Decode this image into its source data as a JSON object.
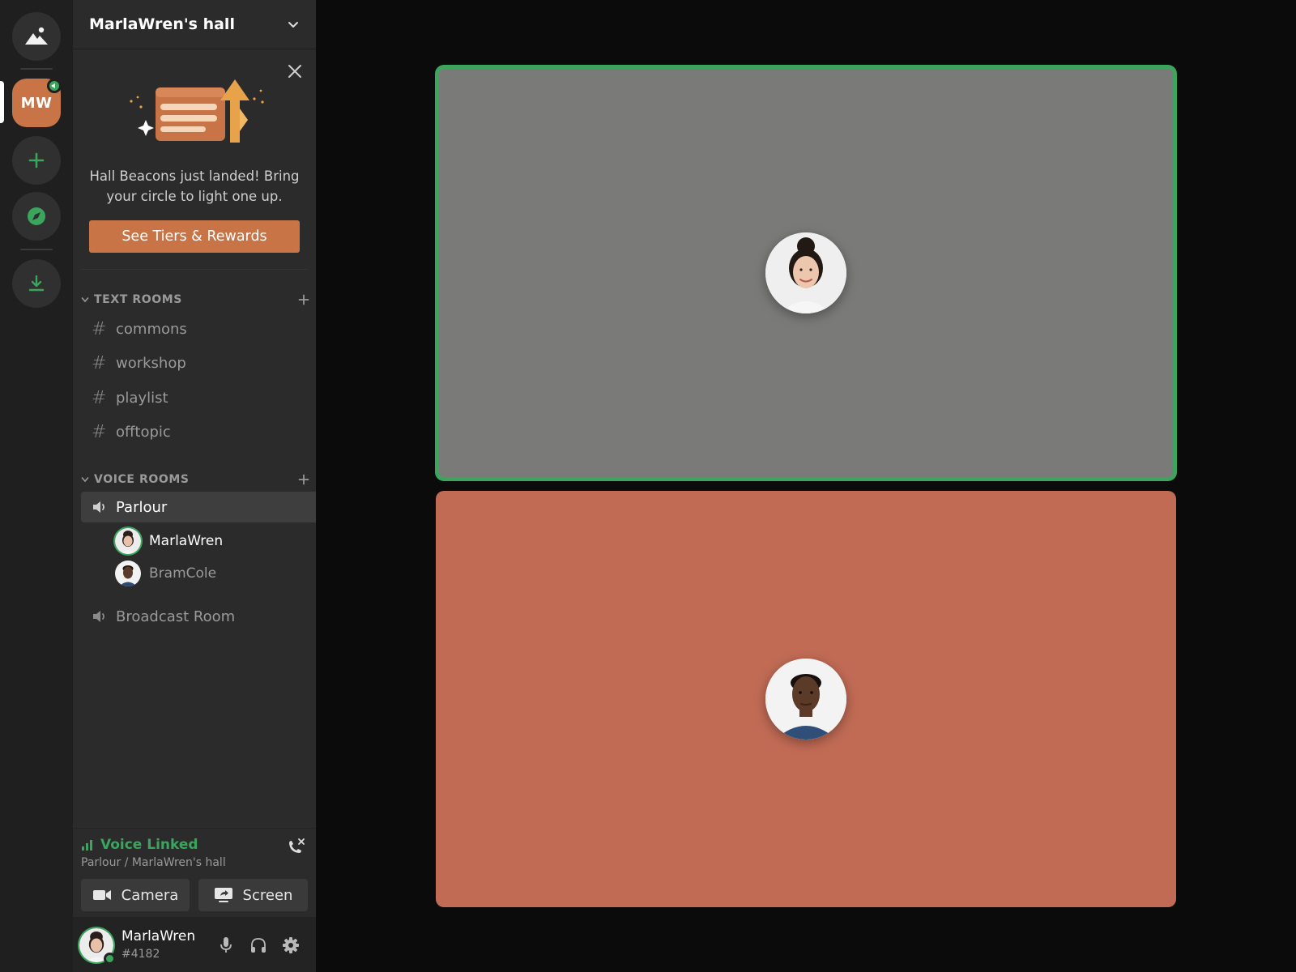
{
  "rail": {
    "home_icon": "mountain-icon",
    "active_server_initials": "MW",
    "add_icon": "plus-icon",
    "explore_icon": "compass-icon",
    "download_icon": "download-icon"
  },
  "sidebar": {
    "hall_title": "MarlaWren's hall",
    "promo": {
      "text": "Hall Beacons just landed! Bring your circle to light one up.",
      "button_label": "See Tiers & Rewards"
    },
    "text_category": "TEXT ROOMS",
    "text_channels": [
      "commons",
      "workshop",
      "playlist",
      "offtopic"
    ],
    "voice_category": "VOICE ROOMS",
    "voice_channels": [
      {
        "name": "Parlour",
        "active": true,
        "members": [
          "MarlaWren",
          "BramCole"
        ]
      },
      {
        "name": "Broadcast Room",
        "active": false,
        "members": []
      }
    ]
  },
  "voice_panel": {
    "status": "Voice Linked",
    "location": "Parlour / MarlaWren's hall",
    "camera_label": "Camera",
    "screen_label": "Screen"
  },
  "user_panel": {
    "name": "MarlaWren",
    "tag": "#4182"
  },
  "colors": {
    "accent_green": "#3ba55d",
    "brand_orange": "#c87446",
    "tile_one_bg": "#7a7b78",
    "tile_two_bg": "#c16b55"
  }
}
